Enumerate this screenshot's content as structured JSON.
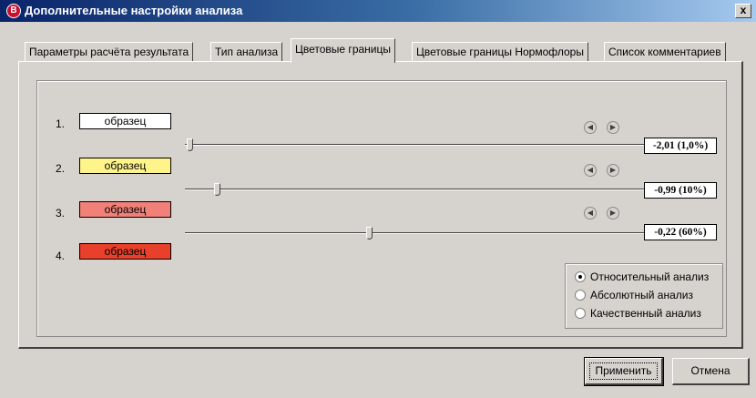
{
  "window": {
    "title": "Дополнительные настройки анализа",
    "icon_letter": "B",
    "close_glyph": "x"
  },
  "tabs": [
    {
      "label": "Параметры расчёта результата",
      "active": false
    },
    {
      "label": "Тип анализа",
      "active": false
    },
    {
      "label": "Цветовые границы",
      "active": true
    },
    {
      "label": "Цветовые границы Нормофлоры",
      "active": false
    },
    {
      "label": "Список комментариев",
      "active": false
    }
  ],
  "color_rows": [
    {
      "number": "1.",
      "swatch_text": "образец",
      "color": "#ffffff"
    },
    {
      "number": "2.",
      "swatch_text": "образец",
      "color": "#fff48a"
    },
    {
      "number": "3.",
      "swatch_text": "образец",
      "color": "#f08078"
    },
    {
      "number": "4.",
      "swatch_text": "образец",
      "color": "#e8402a"
    }
  ],
  "thresholds": [
    {
      "value": "-2,01 (1,0%)",
      "slider_fraction": 0.01
    },
    {
      "value": "-0,99 (10%)",
      "slider_fraction": 0.07
    },
    {
      "value": "-0,22 (60%)",
      "slider_fraction": 0.4
    }
  ],
  "icons": {
    "left": "arrow-left-icon",
    "right": "arrow-right-icon"
  },
  "arrow_glyphs": {
    "left": "◀",
    "right": "▶"
  },
  "analysis_mode": {
    "options": [
      {
        "label": "Относительный анализ",
        "checked": true
      },
      {
        "label": "Абсолютный анализ",
        "checked": false
      },
      {
        "label": "Качественный анализ",
        "checked": false
      }
    ]
  },
  "buttons": {
    "apply": "Применить",
    "cancel": "Отмена"
  }
}
